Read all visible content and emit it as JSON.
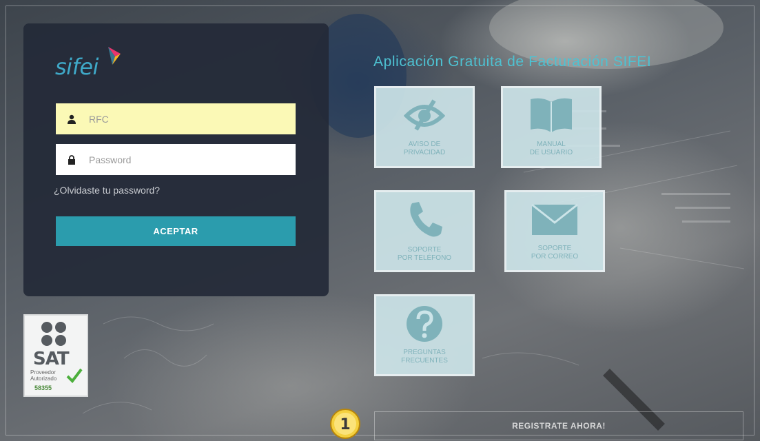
{
  "login": {
    "logo_text": "sifei",
    "rfc_placeholder": "RFC",
    "password_placeholder": "Password",
    "forgot_label": "¿Olvidaste tu password?",
    "accept_label": "ACEPTAR"
  },
  "sat_badge": {
    "title": "SAT",
    "subtitle": "Proveedor Autorizado",
    "number": "58355"
  },
  "app_title": "Aplicación Gratuita de Facturación SIFEI",
  "tiles": [
    {
      "line1": "AVISO DE",
      "line2": "PRIVACIDAD",
      "icon": "eye-slash-icon"
    },
    {
      "line1": "MANUAL",
      "line2": "DE USUARIO",
      "icon": "book-icon"
    },
    {
      "line1": "SOPORTE",
      "line2": "POR TELÉFONO",
      "icon": "phone-icon"
    },
    {
      "line1": "SOPORTE",
      "line2": "POR CORREO",
      "icon": "envelope-icon"
    },
    {
      "line1": "PREGUNTAS",
      "line2": "FRECUENTES",
      "icon": "question-icon"
    }
  ],
  "register_label": "REGISTRATE AHORA!",
  "step_marker": "1",
  "colors": {
    "accent": "#2b9cad",
    "title": "#4ec2d2",
    "panel": "#232a38",
    "rfc_field": "#fbf9b6"
  }
}
